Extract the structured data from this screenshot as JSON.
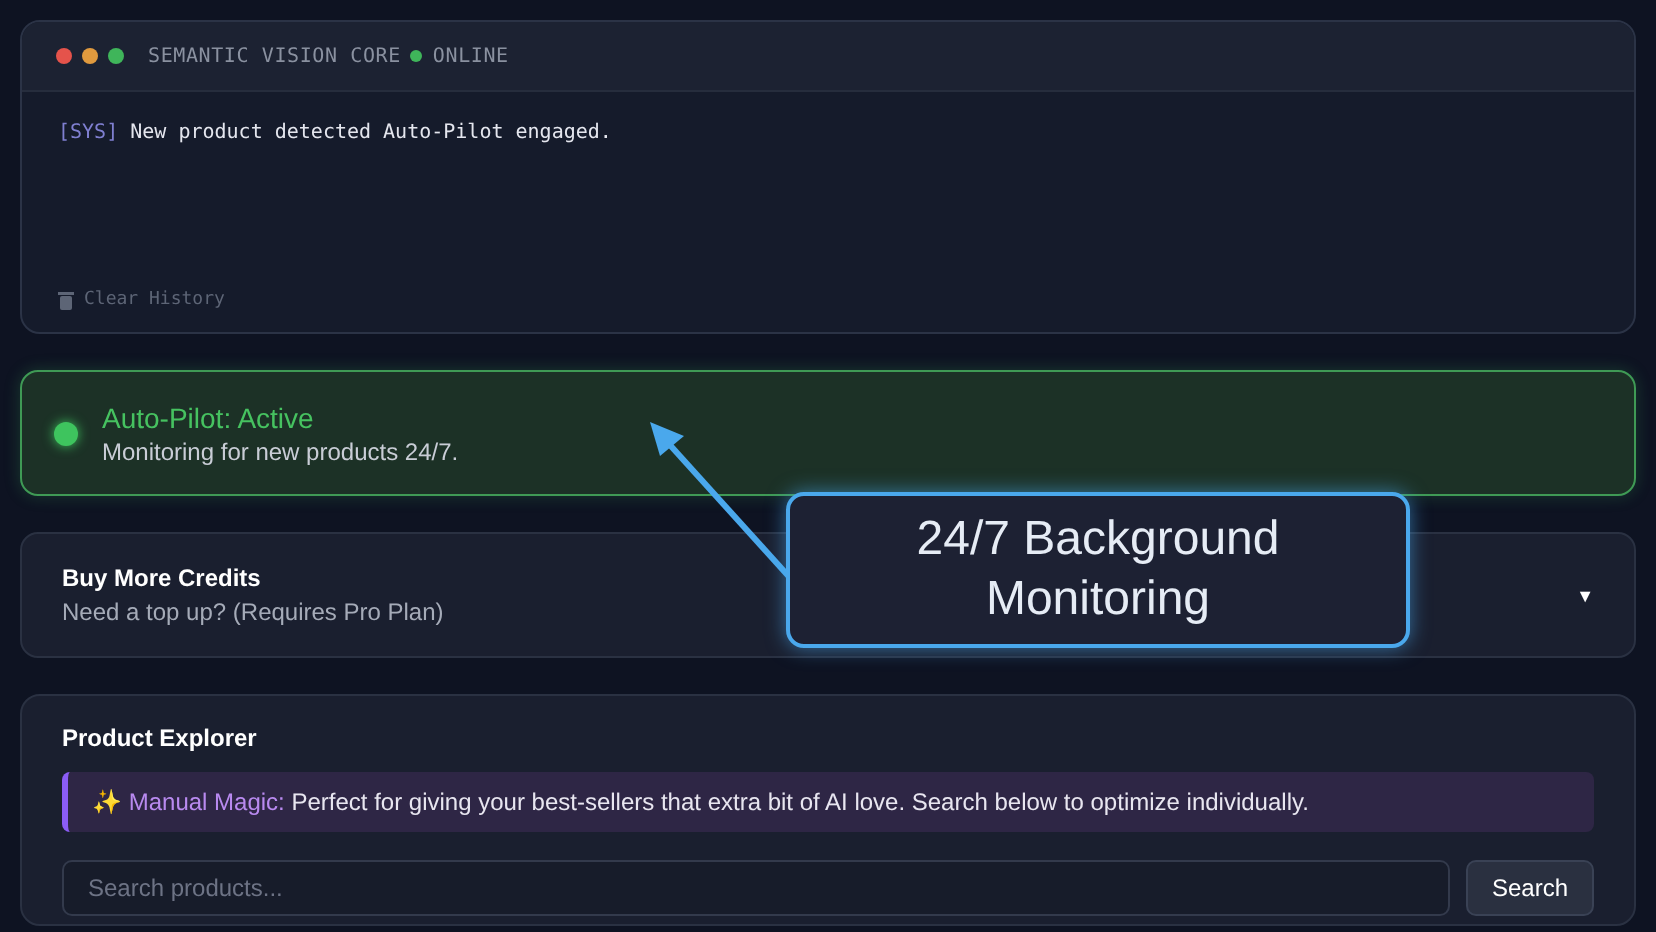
{
  "console": {
    "title": "SEMANTIC VISION CORE",
    "status": "ONLINE",
    "online": true,
    "logs": [
      {
        "tag": "[SYS]",
        "text": "New product detected Auto-Pilot engaged."
      }
    ],
    "clear_button": "Clear History"
  },
  "autopilot": {
    "title": "Auto-Pilot: Active",
    "subtitle": "Monitoring for new products 24/7.",
    "active": true
  },
  "credits": {
    "title": "Buy More Credits",
    "subtitle": "Need a top up? (Requires Pro Plan)",
    "expanded": false,
    "caret": "▼"
  },
  "explorer": {
    "title": "Product Explorer",
    "tip": {
      "icon": "✨",
      "label": "Manual Magic:",
      "text": "Perfect for giving your best-sellers that extra bit of AI love. Search below to optimize individually."
    },
    "search": {
      "placeholder": "Search products..."
    },
    "search_button": "Search"
  },
  "callout": {
    "text": "24/7 Background Monitoring"
  }
}
